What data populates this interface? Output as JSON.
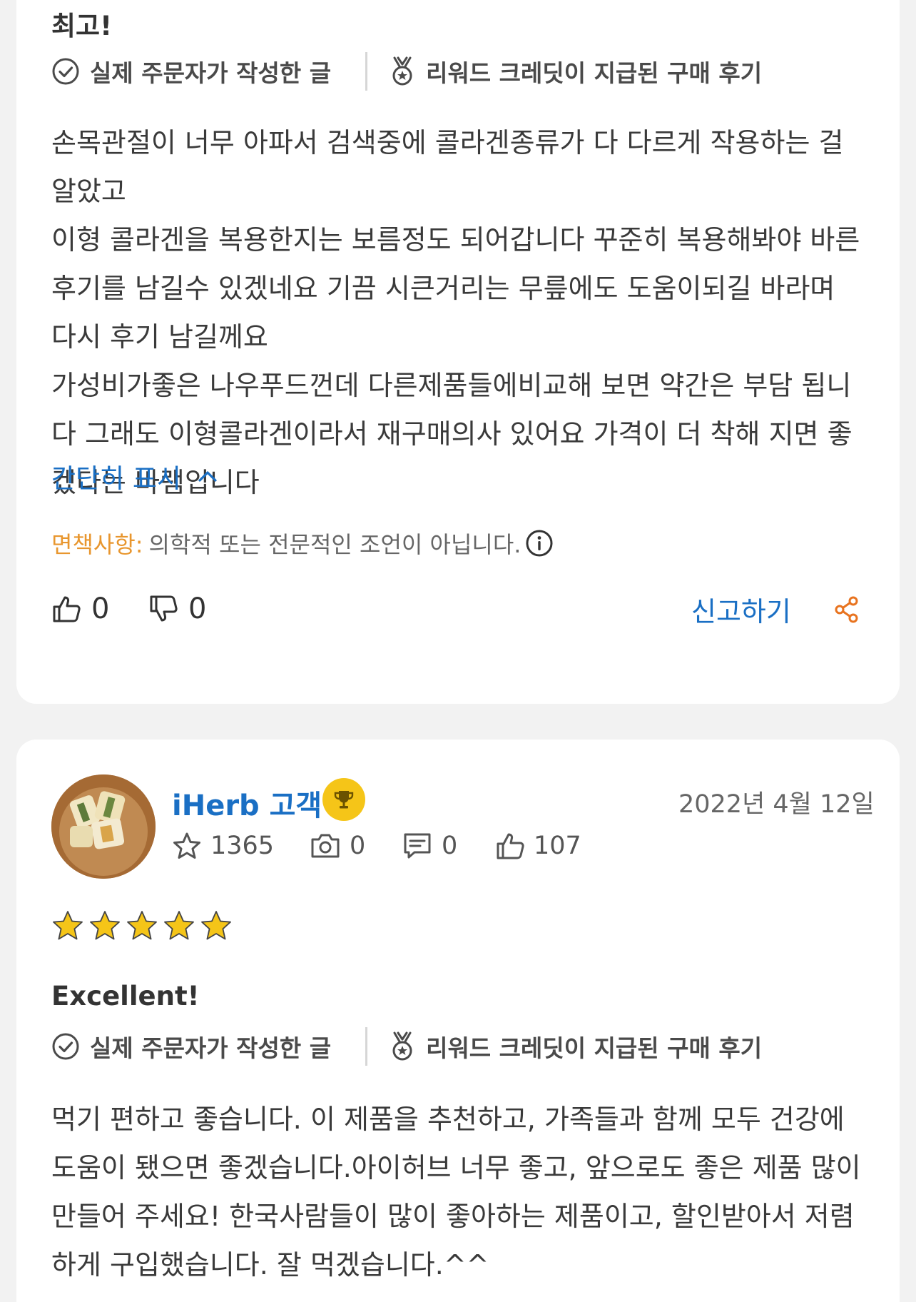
{
  "colors": {
    "link_blue": "#1a6fc4",
    "disclaimer_orange": "#e8962e",
    "star_gold": "#f5c518",
    "share_orange": "#e8731f",
    "text_dark": "#333333",
    "background": "#f2f2f2"
  },
  "review1": {
    "title": "최고!",
    "badges": {
      "verified": {
        "icon": "check-circle-icon",
        "label": "실제 주문자가 작성한 글"
      },
      "rewarded": {
        "icon": "medal-icon",
        "label": "리워드 크레딧이 지급된 구매 후기"
      }
    },
    "body": [
      "손목관절이 너무 아파서  검색중에  콜라겐종류가 다 다르게  작용하는 걸 알았고",
      "이형 콜라겐을  복용한지는  보름정도 되어갑니다  꾸준히 복용해봐야 바른  후기를 남길수 있겠네요  기끔 시큰거리는  무릎에도 도움이되길 바라며 다시 후기 남길께요",
      "가성비가좋은  나우푸드껀데  다른제품들에비교해 보면  약간은  부담 됩니다  그래도 이형콜라겐이라서  재구매의사 있어요  가격이 더 착해 지면 좋겠다는  바램입니다"
    ],
    "collapse_label": "간단히 표시",
    "disclaimer": {
      "label": "면책사항:",
      "text": "의학적 또는 전문적인 조언이 아닙니다."
    },
    "helpful_count": "0",
    "unhelpful_count": "0",
    "report_label": "신고하기"
  },
  "review2": {
    "reviewer_name": "iHerb 고객",
    "reviewer_badge_icon": "trophy-icon",
    "date": "2022년 4월 12일",
    "stats": {
      "reviews": "1365",
      "photos": "0",
      "comments": "0",
      "helpful": "107"
    },
    "rating": 5,
    "rating_max": 5,
    "title": "Excellent!",
    "badges": {
      "verified": {
        "icon": "check-circle-icon",
        "label": "실제 주문자가 작성한 글"
      },
      "rewarded": {
        "icon": "medal-icon",
        "label": "리워드 크레딧이 지급된 구매 후기"
      }
    },
    "body": "먹기 편하고 좋습니다. 이 제품을 추천하고, 가족들과 함께 모두 건강에 도움이 됐으면 좋겠습니다.아이허브 너무 좋고, 앞으로도 좋은 제품 많이 만들어 주세요! 한국사람들이 많이 좋아하는 제품이고, 할인받아서 저렴하게 구입했습니다. 잘 먹겠습니다.^^"
  }
}
